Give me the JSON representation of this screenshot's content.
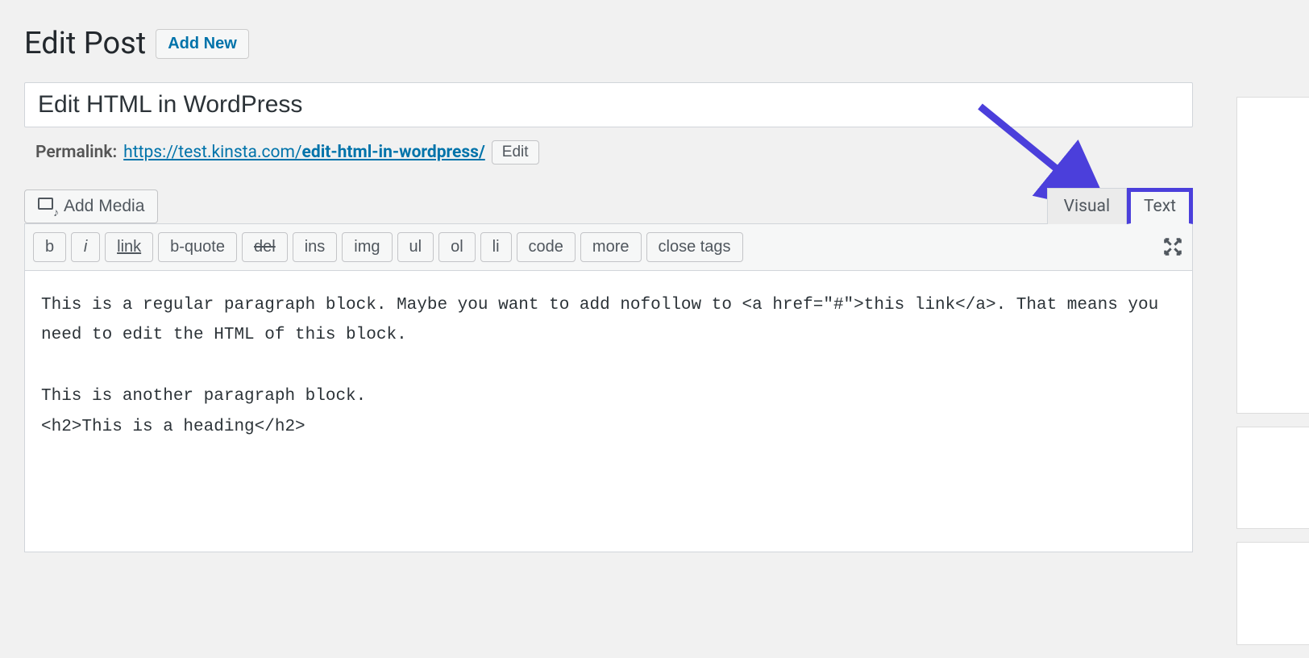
{
  "header": {
    "page_title": "Edit Post",
    "add_new_label": "Add New"
  },
  "post": {
    "title": "Edit HTML in WordPress",
    "permalink_label": "Permalink:",
    "permalink_base": "https://test.kinsta.com/",
    "permalink_slug": "edit-html-in-wordpress/",
    "permalink_edit_label": "Edit"
  },
  "media": {
    "add_media_label": "Add Media"
  },
  "tabs": {
    "visual_label": "Visual",
    "text_label": "Text"
  },
  "toolbar": {
    "buttons": [
      {
        "label": "b",
        "style": ""
      },
      {
        "label": "i",
        "style": "italic"
      },
      {
        "label": "link",
        "style": "underline"
      },
      {
        "label": "b-quote",
        "style": ""
      },
      {
        "label": "del",
        "style": "strike"
      },
      {
        "label": "ins",
        "style": ""
      },
      {
        "label": "img",
        "style": ""
      },
      {
        "label": "ul",
        "style": ""
      },
      {
        "label": "ol",
        "style": ""
      },
      {
        "label": "li",
        "style": ""
      },
      {
        "label": "code",
        "style": ""
      },
      {
        "label": "more",
        "style": ""
      },
      {
        "label": "close tags",
        "style": ""
      }
    ]
  },
  "content": "This is a regular paragraph block. Maybe you want to add nofollow to <a href=\"#\">this link</a>. That means you need to edit the HTML of this block.\n\nThis is another paragraph block.\n<h2>This is a heading</h2>"
}
